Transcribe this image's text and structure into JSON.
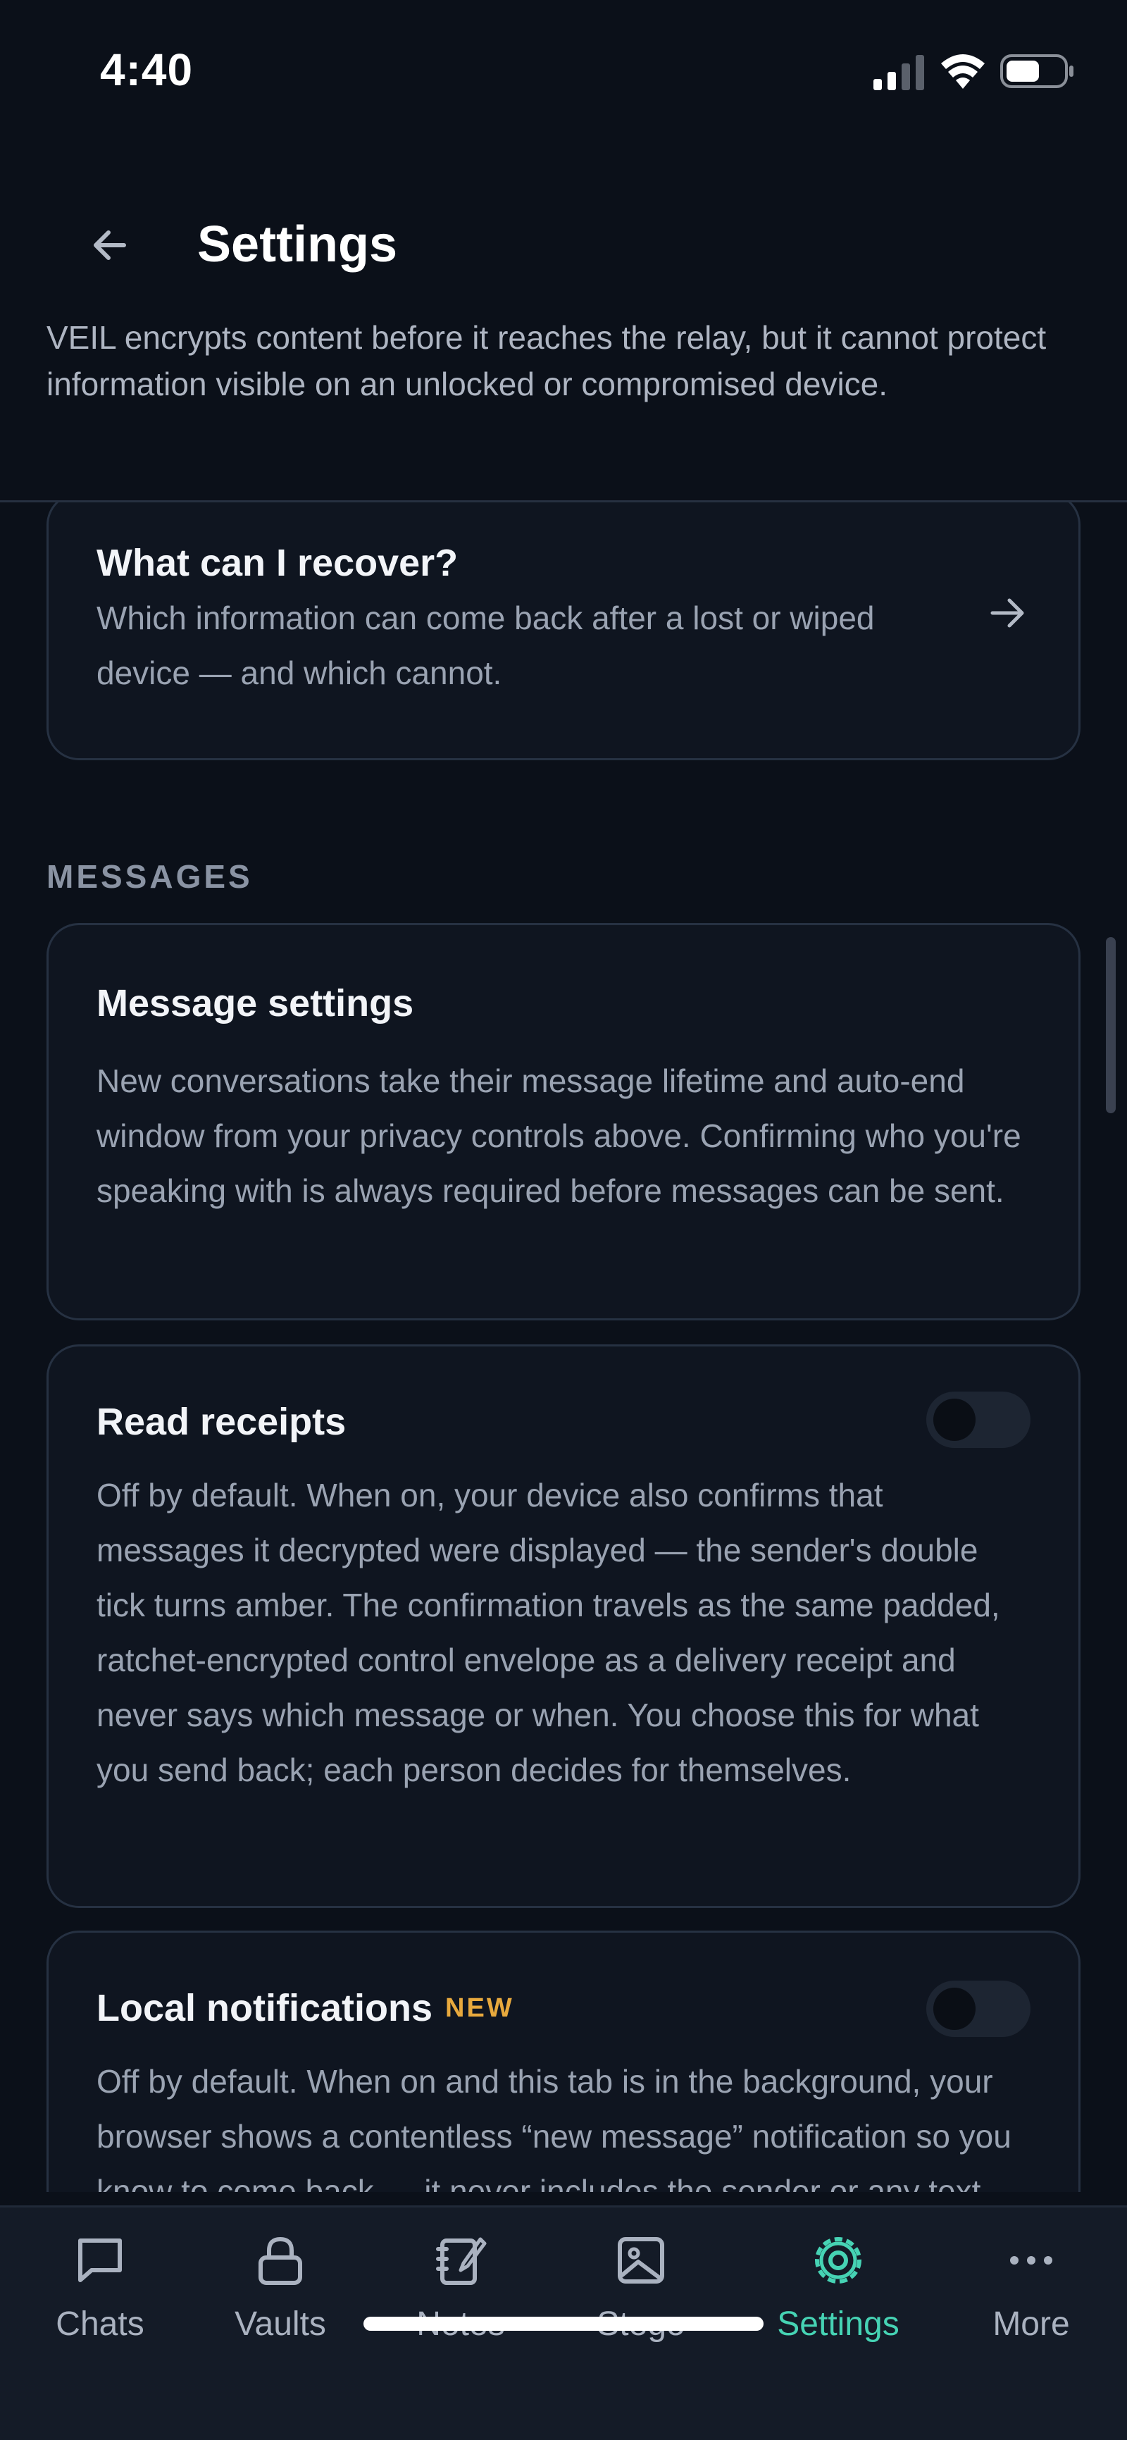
{
  "status_bar": {
    "time": "4:40"
  },
  "header": {
    "title": "Settings",
    "intro": "VEIL encrypts content before it reaches the relay, but it cannot protect information visible on an unlocked or compromised device."
  },
  "recover_card": {
    "title": "What can I recover?",
    "body": "Which information can come back after a lost or wiped device — and which cannot."
  },
  "messages_section": {
    "label": "MESSAGES",
    "message_settings": {
      "title": "Message settings",
      "body": "New conversations take their message lifetime and auto-end window from your privacy controls above. Confirming who you're speaking with is always required before messages can be sent."
    },
    "read_receipts": {
      "title": "Read receipts",
      "enabled": false,
      "body": "Off by default. When on, your device also confirms that messages it decrypted were displayed — the sender's double tick turns amber. The confirmation travels as the same padded, ratchet-encrypted control envelope as a delivery receipt and never says which message or when. You choose this for what you send back; each person decides for themselves."
    },
    "local_notifications": {
      "title": "Local notifications",
      "badge": "NEW",
      "enabled": false,
      "body": "Off by default. When on and this tab is in the background, your browser shows a contentless “new message” notification so you know to come back — it never includes the sender or any text."
    }
  },
  "tabbar": {
    "tabs": [
      {
        "label": "Chats",
        "icon": "chat-icon",
        "active": false
      },
      {
        "label": "Vaults",
        "icon": "lock-icon",
        "active": false
      },
      {
        "label": "Notes",
        "icon": "notes-icon",
        "active": false
      },
      {
        "label": "Stego",
        "icon": "image-icon",
        "active": false
      },
      {
        "label": "Settings",
        "icon": "gear-icon",
        "active": true
      },
      {
        "label": "More",
        "icon": "more-icon",
        "active": false
      }
    ]
  },
  "colors": {
    "accent": "#46d3b4",
    "badge": "#e8a93d",
    "background": "#0b1019"
  }
}
